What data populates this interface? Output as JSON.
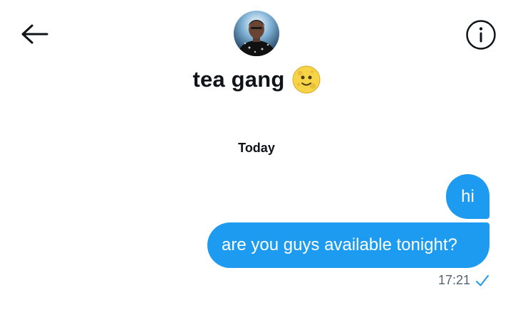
{
  "header": {
    "back_icon": "arrow-left-icon",
    "info_icon": "info-circle-icon",
    "title": "tea gang",
    "title_emoji": "moon-face-emoji"
  },
  "conversation": {
    "date_divider": "Today",
    "messages": [
      {
        "text": "hi",
        "sender": "self"
      },
      {
        "text": "are you guys available tonight?",
        "sender": "self"
      }
    ],
    "last_timestamp": "17:21",
    "status_icon": "checkmark-sent-icon"
  },
  "colors": {
    "accent": "#1d9bf0",
    "text_primary": "#0f1419",
    "text_secondary": "#536471",
    "background": "#ffffff"
  }
}
